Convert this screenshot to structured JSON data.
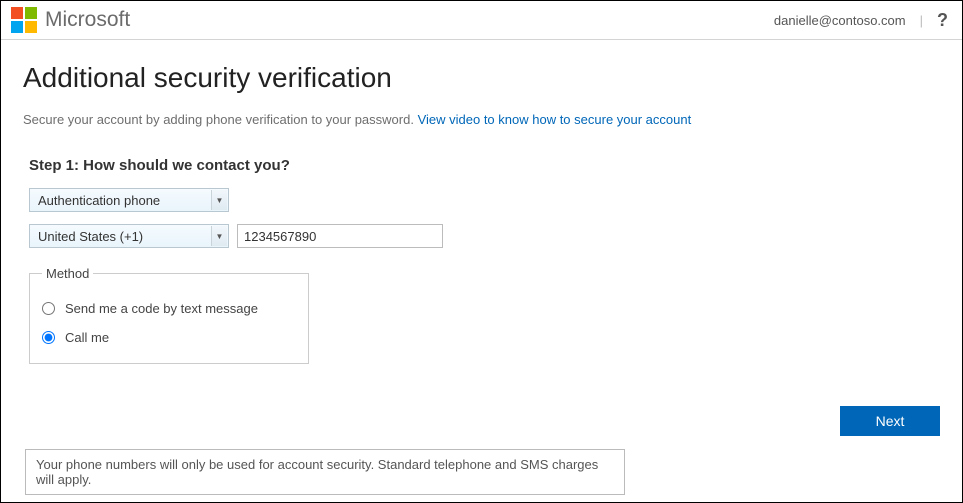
{
  "header": {
    "brand": "Microsoft",
    "user_email": "danielle@contoso.com",
    "help_glyph": "?"
  },
  "page": {
    "title": "Additional security verification",
    "intro_prefix": "Secure your account by adding phone verification to your password. ",
    "intro_link": "View video to know how to secure your account",
    "step_title": "Step 1: How should we contact you?"
  },
  "contact_method_select": {
    "selected": "Authentication phone"
  },
  "country_select": {
    "selected": "United States (+1)"
  },
  "phone_input": {
    "value": "1234567890"
  },
  "method_fieldset": {
    "legend": "Method",
    "options": {
      "text": "Send me a code by text message",
      "call": "Call me"
    },
    "selected": "call"
  },
  "buttons": {
    "next": "Next"
  },
  "disclaimer": "Your phone numbers will only be used for account security. Standard telephone and SMS charges will apply."
}
